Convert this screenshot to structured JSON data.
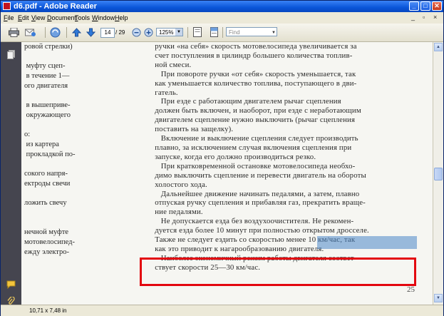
{
  "window": {
    "title": "d6.pdf - Adobe Reader",
    "controls": {
      "minimize": "_",
      "maximize": "□",
      "close": "✕"
    }
  },
  "menu": {
    "items": [
      "File",
      "Edit",
      "View",
      "Document",
      "Tools",
      "Window",
      "Help"
    ],
    "doc_controls": {
      "minimize": "_",
      "restore": "▫",
      "close": "×"
    }
  },
  "toolbar": {
    "page_current": "14",
    "page_total": "/ 29",
    "zoom": "125%",
    "find_placeholder": "Find"
  },
  "document": {
    "left_column": [
      "ровой стрелки)",
      "",
      " муфту сцеп-",
      " в течение 1—",
      "ого двигателя",
      "",
      " в вышеприве-",
      " окружающего",
      "",
      "о:",
      " из картера",
      " прокладкой по-",
      "",
      "сокого напря-",
      "ектроды свечи",
      "",
      "ложить свечу",
      "",
      "",
      "нечной муфте",
      "мотовелосипед-",
      "ежду электро-"
    ],
    "right_column": [
      "     ручки «на себя» скорость мотовелосипеда увеличивается за",
      "     счет поступления в цилиндр большего количества топлив-",
      "     ной смеси.",
      "        При повороте ручки «от себя» скорость уменьшается, так",
      "     как уменьшается количество топлива, поступающего в дви-",
      "     гатель.",
      "        При езде с работающим двигателем рычаг сцепления",
      "     должен быть включен, и наоборот, при езде с неработающим",
      "     двигателем сцепление нужно выключить (рычаг сцепления",
      "     поставить на защелку).",
      "        Включение и выключение сцепления следует производить",
      "     плавно, за исключением случая включения сцепления при",
      "     запуске, когда его должно производиться резко.",
      "        При кратковременной остановке мотовелосипеда необхо-",
      "     димо выключить сцепление и перевести двигатель на обороты",
      "     холостого хода.",
      "        Дальнейшее движение начинать педалями, а затем, плавно",
      "     отпуская ручку сцепления и прибавляя газ, прекратить враще-",
      "     ние педалями.",
      "        Не допускается езда без воздухоочистителя. Не рекомен-",
      "     дуется езда более 10 минут при полностью открытом дросселе.",
      "     Также не следует ездить со скоростью менее 10 км/час, так",
      "     как это приводит к нагарообразованию двигателя.",
      "        Наиболее экономичный режим работы двигателя соответ-",
      "     ствует скорости 25—30 км/час."
    ],
    "page_number": "25"
  },
  "status": {
    "dimensions": "10,71 x 7,48 in"
  },
  "colors": {
    "title_bar": "#0a55d8",
    "highlight": "#4b86c8",
    "annotation_box": "#e3070f",
    "nav_panel": "#45454f"
  }
}
